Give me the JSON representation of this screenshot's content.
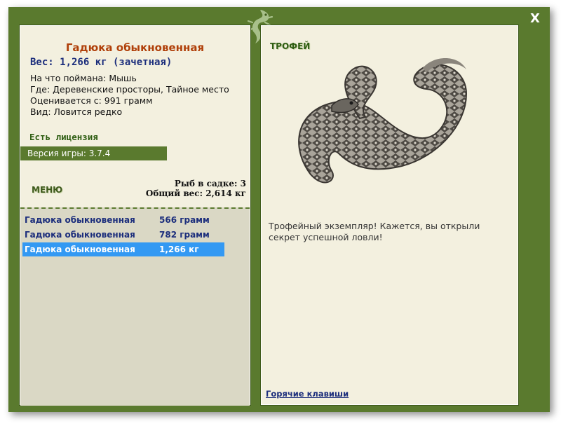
{
  "window": {
    "close_label": "X"
  },
  "fish": {
    "name": "Гадюка обыкновенная",
    "weight_line": "Вес: 1,266 кг (зачетная)",
    "caught_on": "На что поймана: Мышь",
    "location": "Где: Деревенские просторы, Тайное место",
    "value": "Оценивается с: 991 грамм",
    "rarity": "Вид: Ловится редко"
  },
  "license_label": "Есть лицензия",
  "version_label": "Версия игры: 3.7.4",
  "menu_label": "МЕНЮ",
  "stats": {
    "fish_in_keepnet": "Рыб в садке: 3",
    "total_weight": "Общий вес: 2,614 кг"
  },
  "catch_list": [
    {
      "name": "Гадюка обыкновенная",
      "weight": "566 грамм"
    },
    {
      "name": "Гадюка обыкновенная",
      "weight": "782 грамм"
    },
    {
      "name": "Гадюка обыкновенная",
      "weight": "1,266 кг",
      "selected": true
    }
  ],
  "trophy": {
    "label": "ТРОФЕЙ",
    "text": "Трофейный экземпляр! Кажется, вы открыли секрет успешной ловли!",
    "image_icon": "viper-snake-image"
  },
  "hotkeys_label": "Горячие клавиши",
  "colors": {
    "frame": "#5a7a2e",
    "panel": "#f3f0df",
    "title": "#b0400a",
    "accent_text": "#1c2e7c",
    "selection": "#3399f3"
  }
}
